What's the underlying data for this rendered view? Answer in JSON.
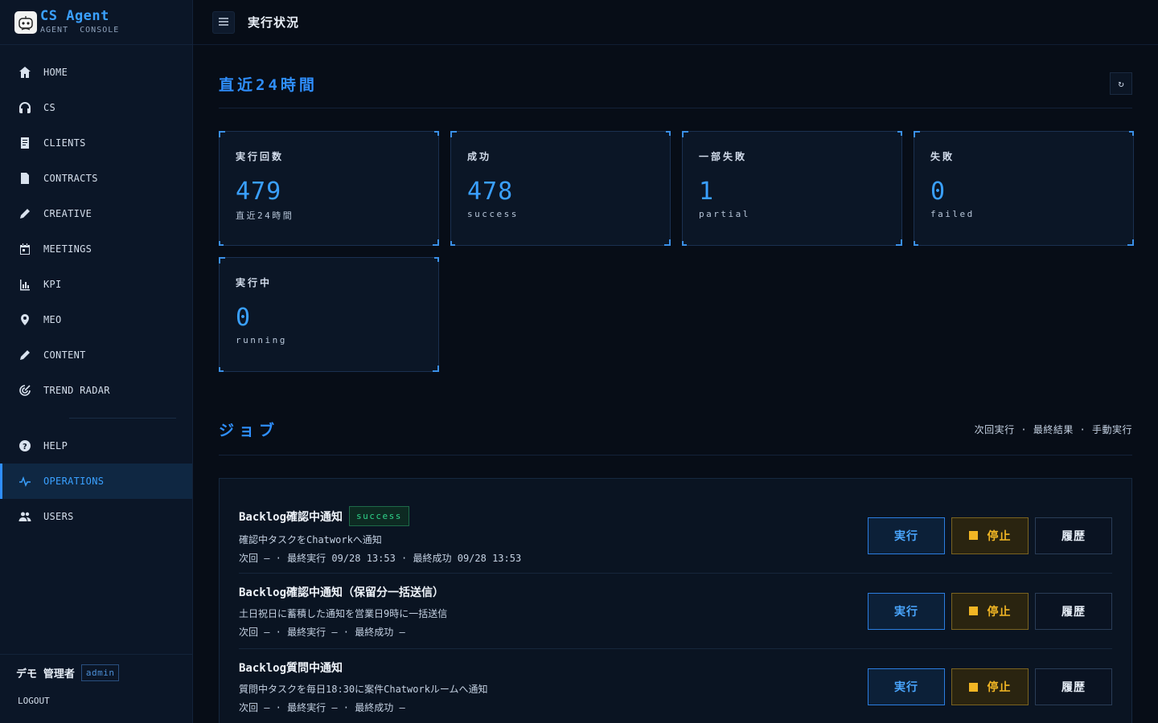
{
  "brand": {
    "title": "CS Agent",
    "subtitle": "AGENT  CONSOLE"
  },
  "sidebar": {
    "items": [
      {
        "label": "HOME",
        "icon": "home-icon"
      },
      {
        "label": "CS",
        "icon": "headset-icon"
      },
      {
        "label": "CLIENTS",
        "icon": "clipboard-icon"
      },
      {
        "label": "CONTRACTS",
        "icon": "document-icon"
      },
      {
        "label": "CREATIVE",
        "icon": "pencil-icon"
      },
      {
        "label": "MEETINGS",
        "icon": "calendar-icon"
      },
      {
        "label": "KPI",
        "icon": "bar-chart-icon"
      },
      {
        "label": "MEO",
        "icon": "map-pin-icon"
      },
      {
        "label": "CONTENT",
        "icon": "pencil-icon"
      },
      {
        "label": "TREND RADAR",
        "icon": "radar-icon"
      }
    ],
    "bottom_items": [
      {
        "label": "HELP",
        "icon": "help-icon"
      },
      {
        "label": "OPERATIONS",
        "icon": "pulse-icon",
        "active": true
      },
      {
        "label": "USERS",
        "icon": "users-icon"
      }
    ],
    "user": {
      "name": "デモ 管理者",
      "role": "admin"
    },
    "logout_label": "LOGOUT"
  },
  "topbar": {
    "title": "実行状況"
  },
  "summary": {
    "title": "直近24時間",
    "refresh_glyph": "↻",
    "stats": [
      {
        "label": "実行回数",
        "value": "479",
        "sub": "直近24時間"
      },
      {
        "label": "成功",
        "value": "478",
        "sub": "success"
      },
      {
        "label": "一部失敗",
        "value": "1",
        "sub": "partial"
      },
      {
        "label": "失敗",
        "value": "0",
        "sub": "failed"
      },
      {
        "label": "実行中",
        "value": "0",
        "sub": "running"
      }
    ]
  },
  "jobs": {
    "title": "ジョブ",
    "legend": "次回実行 · 最終結果 · 手動実行",
    "run_label": "実行",
    "stop_label": "停止",
    "history_label": "履歴",
    "items": [
      {
        "name": "Backlog確認中通知",
        "status": "success",
        "desc": "確認中タスクをChatworkへ通知",
        "meta": "次回 — · 最終実行 09/28 13:53 · 最終成功 09/28 13:53"
      },
      {
        "name": "Backlog確認中通知（保留分一括送信）",
        "status": "",
        "desc": "土日祝日に蓄積した通知を営業日9時に一括送信",
        "meta": "次回 — · 最終実行 — · 最終成功 —"
      },
      {
        "name": "Backlog質問中通知",
        "status": "",
        "desc": "質問中タスクを毎日18:30に案件Chatworkルームへ通知",
        "meta": "次回 — · 最終実行 — · 最終成功 —"
      }
    ]
  },
  "colors": {
    "accent": "#3aa0ff",
    "success": "#2fd38a",
    "warning": "#f2b624",
    "background": "#070d17"
  }
}
